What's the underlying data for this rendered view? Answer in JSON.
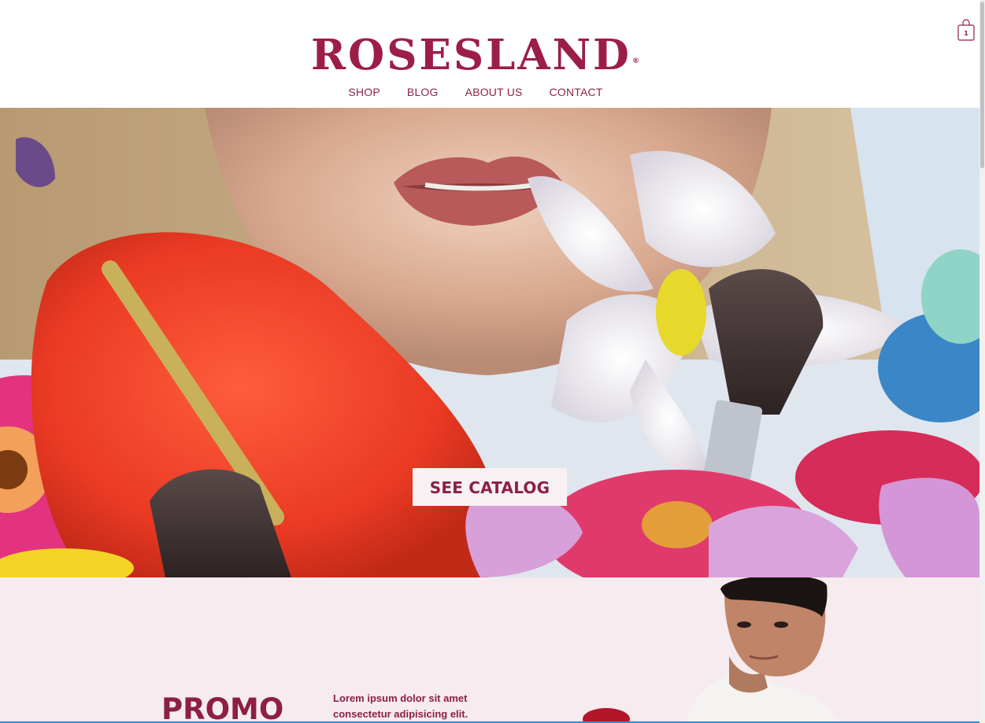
{
  "brand": {
    "name": "ROSESLAND",
    "registered_mark": "®",
    "color": "#9c1d49"
  },
  "nav": {
    "items": [
      {
        "label": "SHOP"
      },
      {
        "label": "BLOG"
      },
      {
        "label": "ABOUT US"
      },
      {
        "label": "CONTACT"
      }
    ]
  },
  "cart": {
    "icon": "shopping-bag-icon",
    "count": "1"
  },
  "hero": {
    "cta_label": "SEE CATALOG"
  },
  "promo": {
    "title": "PROMO",
    "text": "Lorem ipsum dolor sit amet consectetur adipisicing elit.",
    "background": "#f6ebee",
    "accent": "#8d1f45"
  }
}
